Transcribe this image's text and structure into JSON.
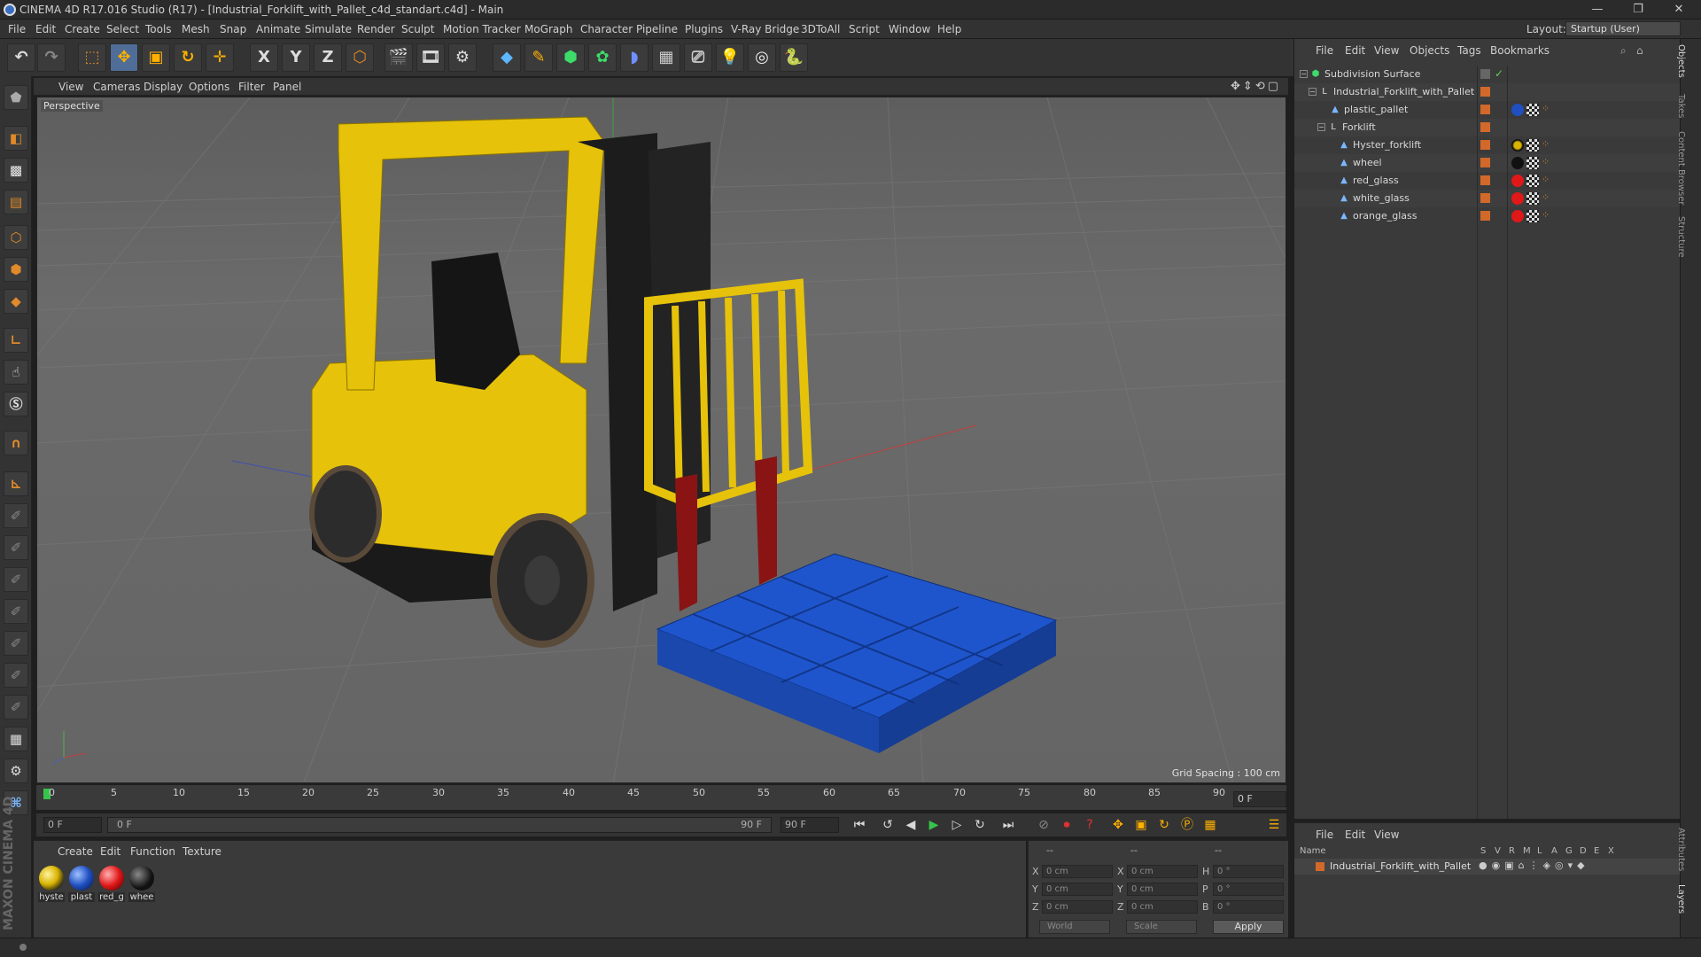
{
  "window": {
    "title": "CINEMA 4D R17.016 Studio (R17) - [Industrial_Forklift_with_Pallet_c4d_standart.c4d] - Main",
    "minimize": "—",
    "maximize": "❐",
    "close": "✕"
  },
  "menubar": {
    "items": [
      "File",
      "Edit",
      "Create",
      "Select",
      "Tools",
      "Mesh",
      "Snap",
      "Animate",
      "Simulate",
      "Render",
      "Sculpt",
      "Motion Tracker",
      "MoGraph",
      "Character",
      "Pipeline",
      "Plugins",
      "V-Ray Bridge",
      "3DToAll",
      "Script",
      "Window",
      "Help"
    ],
    "layout_label": "Layout:",
    "layout_value": "Startup (User)"
  },
  "toolbar": {
    "axis_x": "X",
    "axis_y": "Y",
    "axis_z": "Z"
  },
  "viewport": {
    "menu": [
      "View",
      "Cameras",
      "Display",
      "Options",
      "Filter",
      "Panel"
    ],
    "label": "Perspective",
    "grid_spacing": "Grid Spacing : 100 cm"
  },
  "timeline": {
    "ticks": [
      "0",
      "5",
      "10",
      "15",
      "20",
      "25",
      "30",
      "35",
      "40",
      "45",
      "50",
      "55",
      "60",
      "65",
      "70",
      "75",
      "80",
      "85",
      "90"
    ],
    "current_frame": "0 F"
  },
  "playbar": {
    "start_frame": "0 F",
    "range_start": "0 F",
    "range_end": "90 F",
    "end_frame": "90 F"
  },
  "material_manager": {
    "menu": [
      "Create",
      "Edit",
      "Function",
      "Texture"
    ],
    "materials": [
      {
        "label": "hyste",
        "color": "#d8b300"
      },
      {
        "label": "plast",
        "color": "#1f4fc0"
      },
      {
        "label": "red_g",
        "color": "#e01818"
      },
      {
        "label": "whee",
        "color": "#111111"
      }
    ]
  },
  "coordinates": {
    "header": [
      "--",
      "--",
      "--"
    ],
    "rows": [
      {
        "a": "X",
        "av": "0 cm",
        "b": "X",
        "bv": "0 cm",
        "c": "H",
        "cv": "0 °"
      },
      {
        "a": "Y",
        "av": "0 cm",
        "b": "Y",
        "bv": "0 cm",
        "c": "P",
        "cv": "0 °"
      },
      {
        "a": "Z",
        "av": "0 cm",
        "b": "Z",
        "bv": "0 cm",
        "c": "B",
        "cv": "0 °"
      }
    ],
    "world": "World",
    "scale": "Scale",
    "apply": "Apply"
  },
  "object_manager": {
    "menu": [
      "File",
      "Edit",
      "View",
      "Objects",
      "Tags",
      "Bookmarks"
    ],
    "objects": [
      {
        "name": "Subdivision Surface",
        "indent": 0,
        "expand": "−",
        "icon": "subdivision-icon"
      },
      {
        "name": "Industrial_Forklift_with_Pallet",
        "indent": 1,
        "expand": "−",
        "icon": "null-icon"
      },
      {
        "name": "plastic_pallet",
        "indent": 2,
        "expand": "",
        "icon": "polygon-icon",
        "tag": "#1f4fc0"
      },
      {
        "name": "Forklift",
        "indent": 2,
        "expand": "−",
        "icon": "null-icon"
      },
      {
        "name": "Hyster_forklift",
        "indent": 3,
        "expand": "",
        "icon": "polygon-icon",
        "tag": "#d8b300"
      },
      {
        "name": "wheel",
        "indent": 3,
        "expand": "",
        "icon": "polygon-icon",
        "tag": "#111111"
      },
      {
        "name": "red_glass",
        "indent": 3,
        "expand": "",
        "icon": "polygon-icon",
        "tag": "#e01818"
      },
      {
        "name": "white_glass",
        "indent": 3,
        "expand": "",
        "icon": "polygon-icon",
        "tag": "#e01818"
      },
      {
        "name": "orange_glass",
        "indent": 3,
        "expand": "",
        "icon": "polygon-icon",
        "tag": "#e01818"
      }
    ]
  },
  "layer_manager": {
    "menu": [
      "File",
      "Edit",
      "View"
    ],
    "col_name": "Name",
    "cols": [
      "S",
      "V",
      "R",
      "M",
      "L",
      "A",
      "G",
      "D",
      "E",
      "X"
    ],
    "layer_name": "Industrial_Forklift_with_Pallet"
  },
  "right_tabs": [
    "Objects",
    "Takes",
    "Content Browser",
    "Structure"
  ],
  "right_tabs_bottom": [
    "Attributes",
    "Layers"
  ],
  "brand": "MAXON CINEMA 4D",
  "colors": {
    "accent": "#4f6d96",
    "layer_orange": "#d2692a",
    "forklift_yellow": "#e6c20a",
    "pallet_blue": "#1f55cc"
  }
}
